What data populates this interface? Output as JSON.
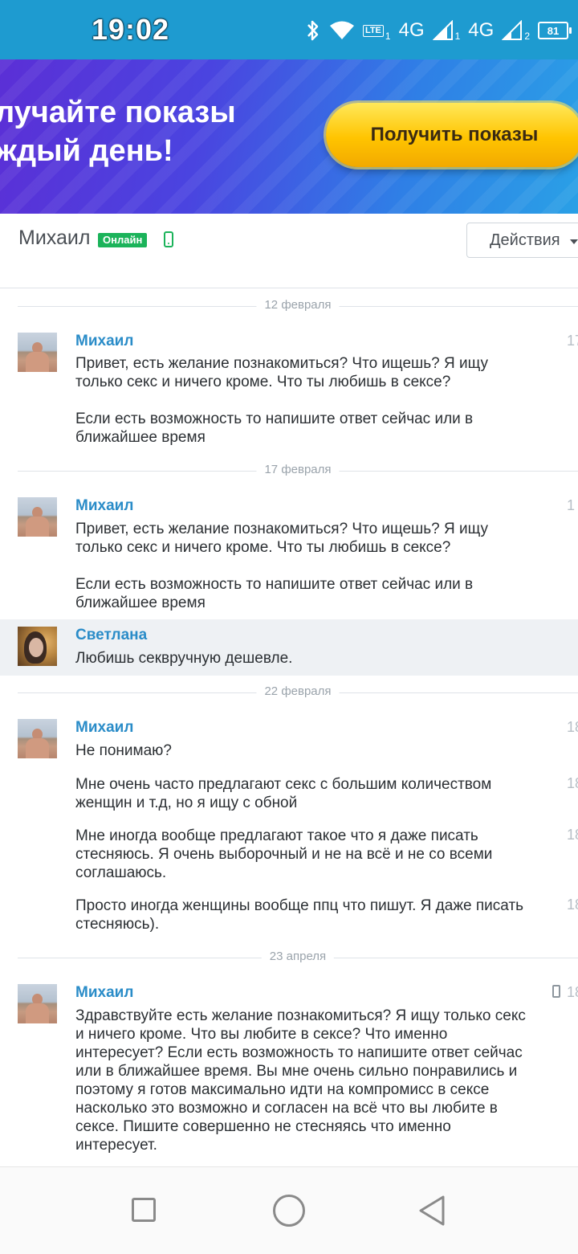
{
  "status_bar": {
    "time": "19:02",
    "network_1": "4G",
    "sim_1": "1",
    "network_2": "4G",
    "sim_2": "2",
    "volte": "LTE",
    "volte_sub": "1",
    "battery": "81",
    "icons": [
      "bluetooth-icon",
      "wifi-icon",
      "volte-icon",
      "signal-icon",
      "signal-icon",
      "battery-icon"
    ]
  },
  "banner": {
    "headline_line1": "лучайте показы",
    "headline_line2": "ждый день!",
    "cta_label": "Получить показы"
  },
  "header": {
    "contact_name": "Михаил",
    "status_badge": "Онлайн",
    "actions_label": "Действия"
  },
  "conversation": {
    "dates": [
      "12 февраля",
      "17 февраля",
      "22 февраля",
      "23 апреля"
    ],
    "messages": [
      {
        "author": "Михаил",
        "time_fragment": "17",
        "text": "Привет, есть желание познакомиться? Что ищешь? Я ищу только секс и ничего кроме. Что ты любишь в сексе?\n\nЕсли есть возможность то напишите ответ сейчас или в ближайшее время"
      },
      {
        "author": "Михаил",
        "time_fragment": "1",
        "text": "Привет, есть желание познакомиться? Что ищешь? Я ищу только секс и ничего кроме. Что ты любишь в сексе?\n\nЕсли есть возможность то напишите ответ сейчас или в ближайшее время"
      },
      {
        "author": "Светлана",
        "text": "Любишь секвручную дешевле."
      },
      {
        "author": "Михаил",
        "time_fragment": "18",
        "text": "Не понимаю?",
        "extra": [
          {
            "text": "Мне очень часто предлагают секс с большим количеством женщин и т.д, но я ищу с обной",
            "time_fragment": "18"
          },
          {
            "text": "Мне иногда вообще предлагают такое что я даже писать стесняюсь. Я очень выборочный и не на всё и не со всеми соглашаюсь.",
            "time_fragment": "18"
          },
          {
            "text": "Просто иногда женщины вообще ппц что пишут. Я даже писать стесняюсь).",
            "time_fragment": "18"
          }
        ]
      },
      {
        "author": "Михаил",
        "time_fragment": "18",
        "text": "Здравствуйте есть желание познакомиться? Я ищу только секс и ничего кроме. Что вы любите в сексе? Что именно интересует? Если есть возможность то напишите ответ сейчас или в ближайшее время. Вы мне очень сильно понравились и поэтому я готов максимально идти на компромисс в сексе насколько это возможно и согласен на всё что вы любите в сексе. Пишите совершенно не стесняясь что именно интересует."
      }
    ]
  },
  "nav": {
    "icons": [
      "recents-square-icon",
      "home-circle-icon",
      "back-triangle-icon"
    ]
  }
}
